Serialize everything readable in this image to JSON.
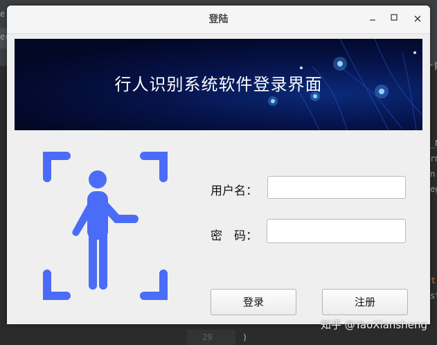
{
  "window": {
    "title": "登陆"
  },
  "banner": {
    "title": "行人识别系统软件登录界面"
  },
  "form": {
    "username_label": "用户名：",
    "username_value": "",
    "password_label": "密　码：",
    "password_value": ""
  },
  "buttons": {
    "login": "登录",
    "register": "注册"
  },
  "background": {
    "frag_top_left": "e",
    "frag_left": "ec",
    "frag_right_top": "-p",
    "frag_right_1": "_N",
    "frag_right_2": "rm",
    "frag_right_3": "n",
    "frag_right_4": "eg",
    "frag_right_5": "t",
    "frag_right_6": "st",
    "line_number": "29",
    "code_fragment": ")",
    "watermark": "知乎 @YaoXiansheng"
  },
  "colors": {
    "icon_blue": "#4a6cf7",
    "banner_dark": "#030a2c",
    "window_bg": "#efefef"
  },
  "icons": [
    "minimize-icon",
    "maximize-icon",
    "close-icon",
    "pedestrian-scan-icon"
  ]
}
